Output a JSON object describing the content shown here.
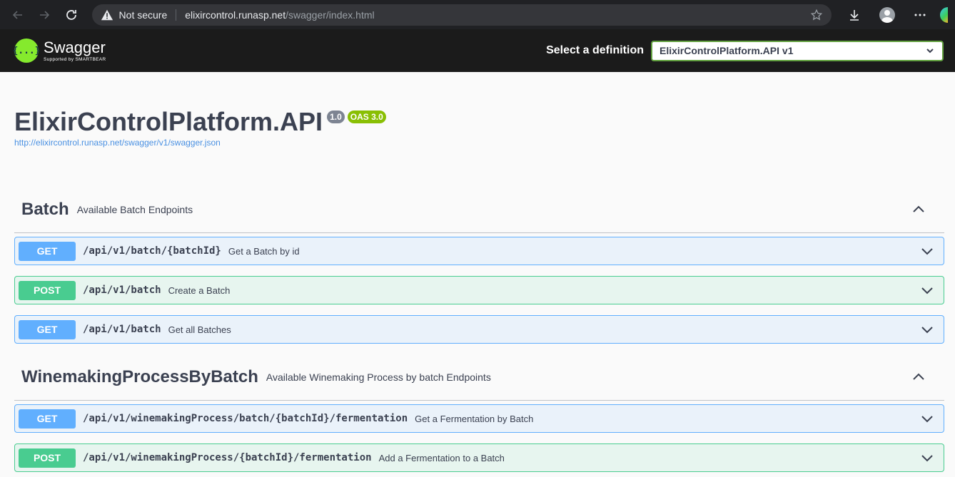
{
  "browser": {
    "not_secure": "Not secure",
    "url_host": "elixircontrol.runasp.net",
    "url_path": "/swagger/index.html"
  },
  "topbar": {
    "logo_symbol": "{...}",
    "logo_title": "Swagger",
    "logo_sub": "Supported by SMARTBEAR",
    "def_label": "Select a definition",
    "def_value": "ElixirControlPlatform.API v1"
  },
  "info": {
    "title": "ElixirControlPlatform.API",
    "version": "1.0",
    "oas": "OAS 3.0",
    "spec_url": "http://elixircontrol.runasp.net/swagger/v1/swagger.json"
  },
  "tags": [
    {
      "name": "Batch",
      "description": "Available Batch Endpoints",
      "operations": [
        {
          "method": "GET",
          "path": "/api/v1/batch/{batchId}",
          "summary": "Get a Batch by id"
        },
        {
          "method": "POST",
          "path": "/api/v1/batch",
          "summary": "Create a Batch"
        },
        {
          "method": "GET",
          "path": "/api/v1/batch",
          "summary": "Get all Batches"
        }
      ]
    },
    {
      "name": "WinemakingProcessByBatch",
      "description": "Available Winemaking Process by batch Endpoints",
      "operations": [
        {
          "method": "GET",
          "path": "/api/v1/winemakingProcess/batch/{batchId}/fermentation",
          "summary": "Get a Fermentation by Batch"
        },
        {
          "method": "POST",
          "path": "/api/v1/winemakingProcess/{batchId}/fermentation",
          "summary": "Add a Fermentation to a Batch"
        }
      ]
    }
  ]
}
